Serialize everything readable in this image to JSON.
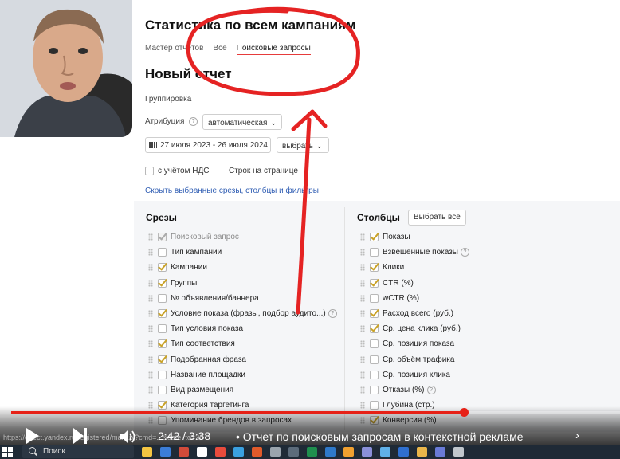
{
  "header": {
    "title": "Статистика по всем кампаниям",
    "tabs": [
      {
        "label": "Мастер отчётов",
        "active": false
      },
      {
        "label": "Все",
        "active": false
      },
      {
        "label": "Поисковые запросы",
        "active": true
      }
    ]
  },
  "report": {
    "title": "Новый отчет",
    "grouping_label": "Группировка",
    "attribution_label": "Атрибуция",
    "attribution_value": "автоматическая",
    "date_range": "27 июля 2023 - 26 июля 2024",
    "period_select": "выбрать",
    "vat_label": "с учётом НДС",
    "vat_checked": false,
    "rows_per_page_label": "Строк на странице",
    "hide_link": "Скрыть выбранные срезы, столбцы и фильтры"
  },
  "slices": {
    "title": "Срезы",
    "items": [
      {
        "label": "Поисковый запрос",
        "checked": true,
        "disabled": true
      },
      {
        "label": "Тип кампании",
        "checked": false
      },
      {
        "label": "Кампании",
        "checked": true
      },
      {
        "label": "Группы",
        "checked": true
      },
      {
        "label": "№ объявления/баннера",
        "checked": false
      },
      {
        "label": "Условие показа (фразы, подбор аудито...)",
        "checked": true,
        "help": true
      },
      {
        "label": "Тип условия показа",
        "checked": false
      },
      {
        "label": "Тип соответствия",
        "checked": true
      },
      {
        "label": "Подобранная фраза",
        "checked": true
      },
      {
        "label": "Название площадки",
        "checked": false
      },
      {
        "label": "Вид размещения",
        "checked": false
      },
      {
        "label": "Категория таргетинга",
        "checked": true
      },
      {
        "label": "Упоминание брендов в запросах",
        "checked": false
      }
    ]
  },
  "columns": {
    "title": "Столбцы",
    "select_all": "Выбрать всё",
    "items": [
      {
        "label": "Показы",
        "checked": true
      },
      {
        "label": "Взвешенные показы",
        "checked": false,
        "help": true
      },
      {
        "label": "Клики",
        "checked": true
      },
      {
        "label": "CTR (%)",
        "checked": true
      },
      {
        "label": "wCTR (%)",
        "checked": false
      },
      {
        "label": "Расход всего (руб.)",
        "checked": true
      },
      {
        "label": "Ср. цена клика (руб.)",
        "checked": true
      },
      {
        "label": "Ср. позиция показа",
        "checked": false
      },
      {
        "label": "Ср. объём трафика",
        "checked": false
      },
      {
        "label": "Ср. позиция клика",
        "checked": false
      },
      {
        "label": "Отказы (%)",
        "checked": false,
        "help": true
      },
      {
        "label": "Глубина (стр.)",
        "checked": false
      },
      {
        "label": "Конверсия (%)",
        "checked": true
      }
    ]
  },
  "video": {
    "time": "2:42 / 3:38",
    "chapter": "• Отчет по поисковым запросам в контекстной рекламе",
    "progress": 0.7431,
    "url_fragment": "https://direct.yandex.ru/registered/main.pl?cmd=...&date_to=26"
  },
  "taskbar": {
    "search_placeholder": "Поиск",
    "icons": [
      "files-icon",
      "mail-icon",
      "browser-icon",
      "chrome-icon",
      "yandex-icon",
      "telegram-icon",
      "music-icon",
      "settings-icon",
      "calculator-icon",
      "excel-icon",
      "edge-icon",
      "paint-icon",
      "tools-icon",
      "chat-icon",
      "mail-app-icon",
      "photos-icon",
      "store-icon",
      "app-icon"
    ]
  },
  "colors": {
    "accent_red": "#e62117",
    "annotation_red": "#e52323",
    "check_yellow": "#c9a227",
    "link_blue": "#2f5db3"
  }
}
